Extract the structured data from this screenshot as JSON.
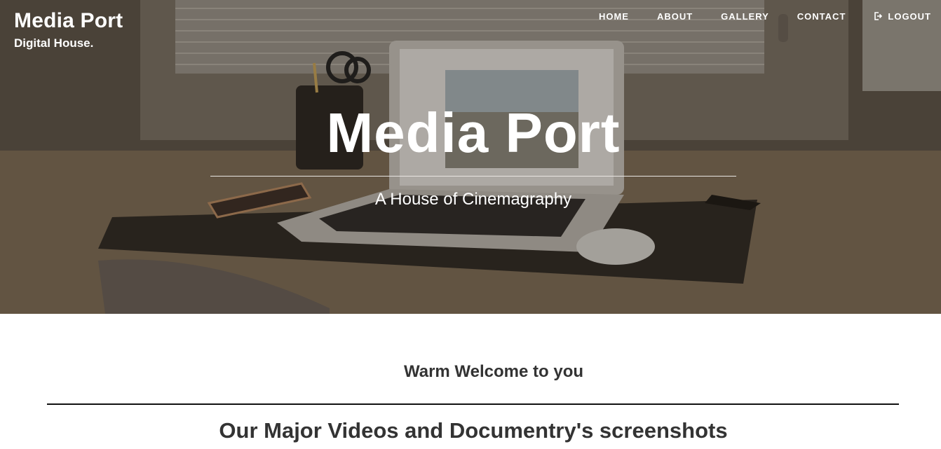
{
  "brand": {
    "title": "Media Port",
    "subtitle": "Digital House."
  },
  "nav": {
    "home": "HOME",
    "about": "ABOUT",
    "gallery": "GALLERY",
    "contact": "CONTACT",
    "logout": "LOGOUT",
    "logout_icon": "logout-icon"
  },
  "hero": {
    "title": "Media Port",
    "tagline": "A House of Cinemagraphy",
    "background": "desk-laptop-photo"
  },
  "main": {
    "welcome": "Warm Welcome to you",
    "section_title": "Our Major Videos and Documentry's screenshots"
  },
  "colors": {
    "text_dark": "#333333",
    "hero_text": "#ffffff",
    "divider": "#111111"
  }
}
